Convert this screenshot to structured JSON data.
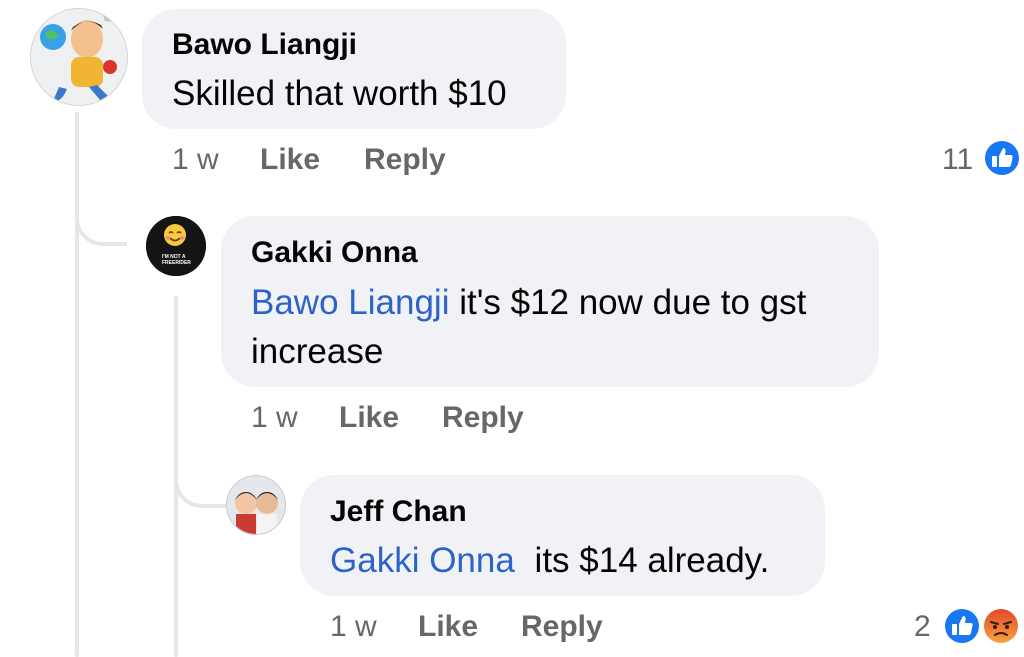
{
  "comments": [
    {
      "author": "Bawo Liangji",
      "text": "Skilled that worth $10",
      "time": "1 w",
      "like_label": "Like",
      "reply_label": "Reply",
      "reaction_count": "11",
      "reactions": [
        "like-icon"
      ]
    },
    {
      "author": "Gakki Onna",
      "mention": "Bawo Liangji",
      "text_line1": " it's $12 now due to gst",
      "text_line2": "increase",
      "time": "1 w",
      "like_label": "Like",
      "reply_label": "Reply",
      "avatar_text": "I'M NOT A FREERIDER"
    },
    {
      "author": "Jeff Chan",
      "mention": "Gakki Onna",
      "text": " its $14 already.",
      "time": "1 w",
      "like_label": "Like",
      "reply_label": "Reply",
      "reaction_count": "2",
      "reactions": [
        "like-icon",
        "angry-icon"
      ]
    }
  ],
  "colors": {
    "bubble": "#f0f2f5",
    "mention": "#2d63c9",
    "like_blue": "#1877f2",
    "angry_orange": "#f06a32",
    "meta_gray": "#65676b"
  }
}
